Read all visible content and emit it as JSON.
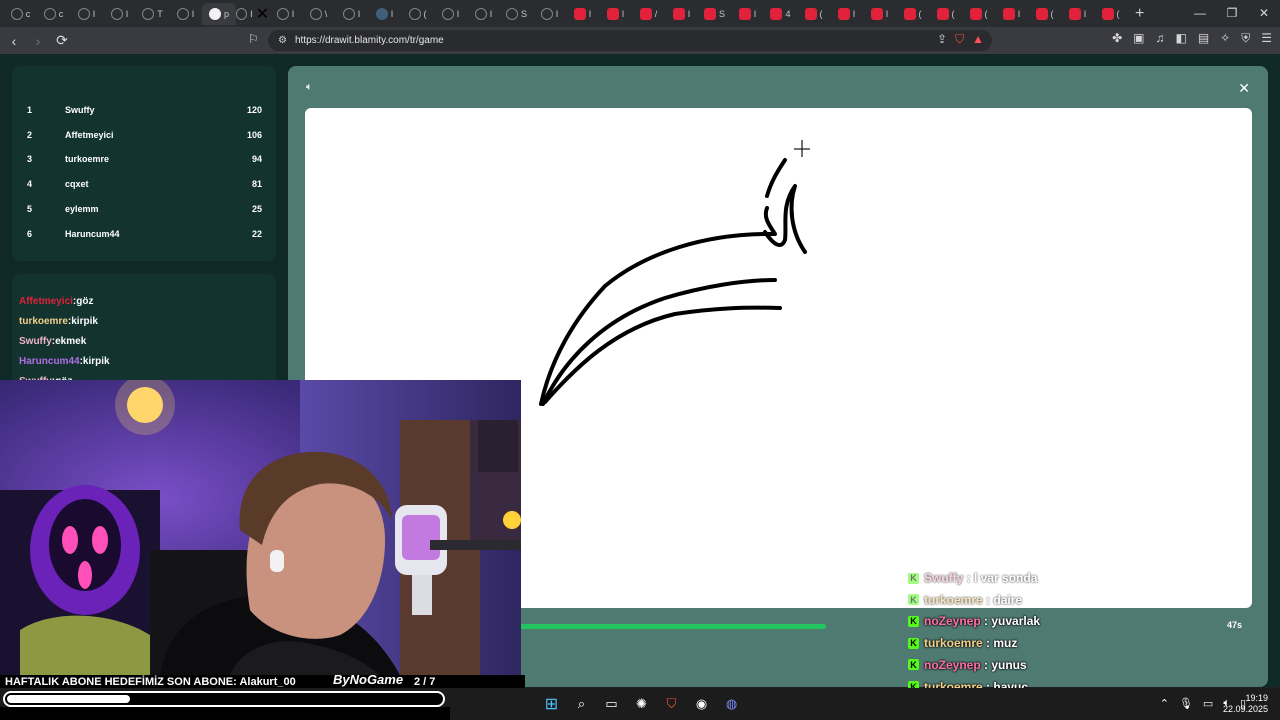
{
  "browser": {
    "url": "https://drawit.blamity.com/tr/game",
    "tab_letters": [
      "c",
      "c",
      "I",
      "I",
      "T",
      "I",
      "p",
      "I",
      "I",
      "\\",
      "I",
      "I",
      "(",
      "I",
      "I",
      "S",
      "I",
      "I",
      "I",
      "/",
      "I",
      "S",
      "I",
      "4",
      "(",
      "I",
      "I",
      "(",
      "(",
      "(",
      "I",
      "(",
      "I",
      "("
    ],
    "new_tab": "+",
    "win": {
      "minimize": "—",
      "maximize": "❐",
      "close": "✕"
    },
    "badge": "0"
  },
  "leaderboard": [
    {
      "rank": "1",
      "name": "Swuffy",
      "score": "120"
    },
    {
      "rank": "2",
      "name": "Affetmeyici",
      "score": "106"
    },
    {
      "rank": "3",
      "name": "turkoemre",
      "score": "94"
    },
    {
      "rank": "4",
      "name": "cqxet",
      "score": "81"
    },
    {
      "rank": "5",
      "name": "eylemm",
      "score": "25"
    },
    {
      "rank": "6",
      "name": "Haruncum44",
      "score": "22"
    }
  ],
  "chat": [
    {
      "user": "Affetmeyici",
      "sep": ":",
      "text": "göz",
      "color": "#e0223a"
    },
    {
      "user": "turkoemre",
      "sep": ":",
      "text": "kirpik",
      "color": "#f3d08a"
    },
    {
      "user": "Swuffy",
      "sep": ":",
      "text": "ekmek",
      "color": "#f0b6c8"
    },
    {
      "user": "Haruncum44",
      "sep": ":",
      "text": "kirpik",
      "color": "#b06ee8"
    },
    {
      "user": "Swuffy",
      "sep": ":",
      "text": "göz",
      "color": "#f0b6c8"
    }
  ],
  "game": {
    "timer": "47s",
    "progress": 0.55,
    "accent": "#22c55e"
  },
  "overlay_chat": [
    {
      "user": "Swuffy",
      "sep": " : ",
      "text": "l var sonda",
      "color": "#f0b6c8",
      "dim": true
    },
    {
      "user": "turkoemre",
      "sep": " : ",
      "text": "daire",
      "color": "#f3d08a",
      "dim": true
    },
    {
      "user": "noZeynep",
      "sep": " : ",
      "text": "yuvarlak",
      "color": "#ff6fa0",
      "dim": false
    },
    {
      "user": "turkoemre",
      "sep": " : ",
      "text": "muz",
      "color": "#f3d08a",
      "dim": false
    },
    {
      "user": "noZeynep",
      "sep": " : ",
      "text": "yunus",
      "color": "#ff6fa0",
      "dim": false
    },
    {
      "user": "turkoemre",
      "sep": " : ",
      "text": "havuç",
      "color": "#f3d08a",
      "dim": false
    }
  ],
  "kick_glyph": "K",
  "stream": {
    "ticker": "HAFTALIK ABONE HEDEFİMİZ SON ABONE: Alakurt_00",
    "brand": "ByNoGame",
    "count": "2 / 7",
    "sub_progress": 0.28
  },
  "taskbar": {
    "time": "19:19",
    "date": "22.09.2025"
  }
}
